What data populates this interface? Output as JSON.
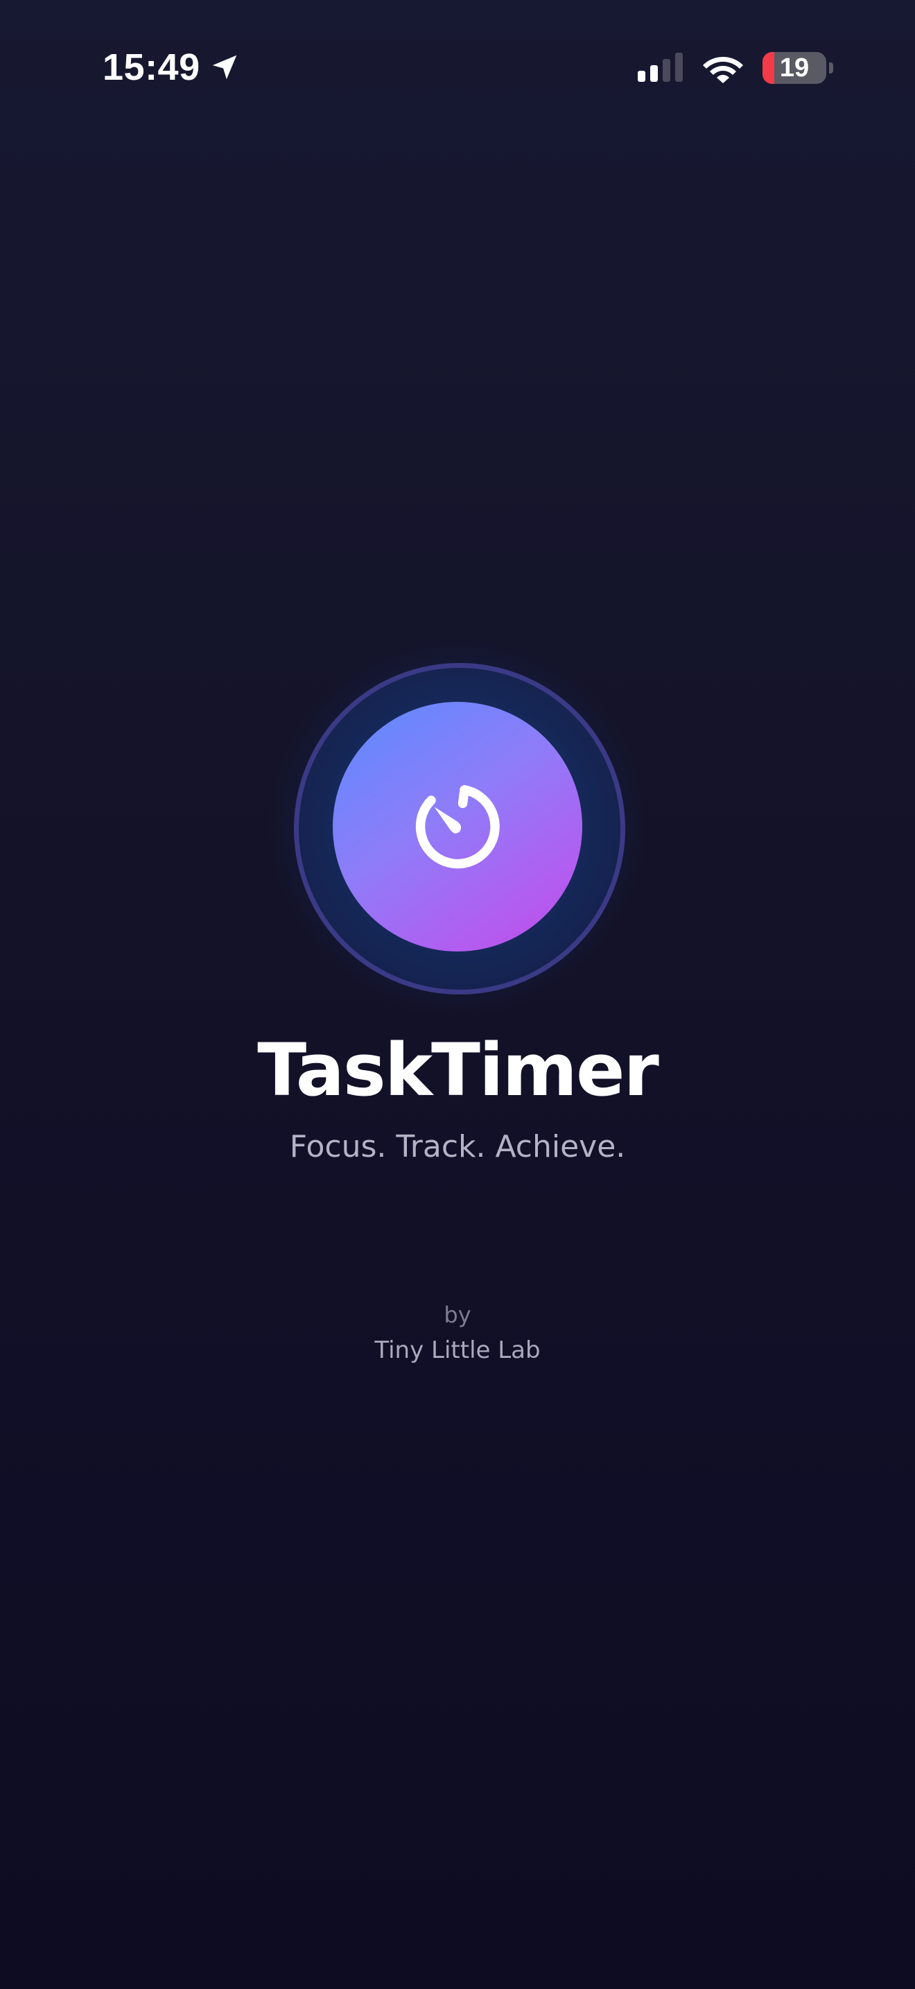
{
  "status_bar": {
    "time": "15:49",
    "location_icon": "location-arrow-icon",
    "signal_icon": "cellular-signal-icon",
    "signal_bars_active": 2,
    "signal_bars_total": 4,
    "wifi_icon": "wifi-icon",
    "battery_icon": "battery-icon",
    "battery_level": "19",
    "battery_fraction": 0.19,
    "battery_color": "#f23b47"
  },
  "splash": {
    "logo_icon": "stopwatch-icon",
    "title": "TaskTimer",
    "tagline": "Focus. Track. Achieve.",
    "credit_by": "by",
    "credit_company": "Tiny Little Lab"
  },
  "colors": {
    "background_top": "#171831",
    "background_bottom": "#0d0c22",
    "logo_gradient_start": "#5a8bff",
    "logo_gradient_end": "#c04ae8",
    "ring": "#3a3a86",
    "tagline": "#b3b3c6",
    "credit_by": "#7c7c93",
    "credit_company": "#a9a9bd"
  }
}
